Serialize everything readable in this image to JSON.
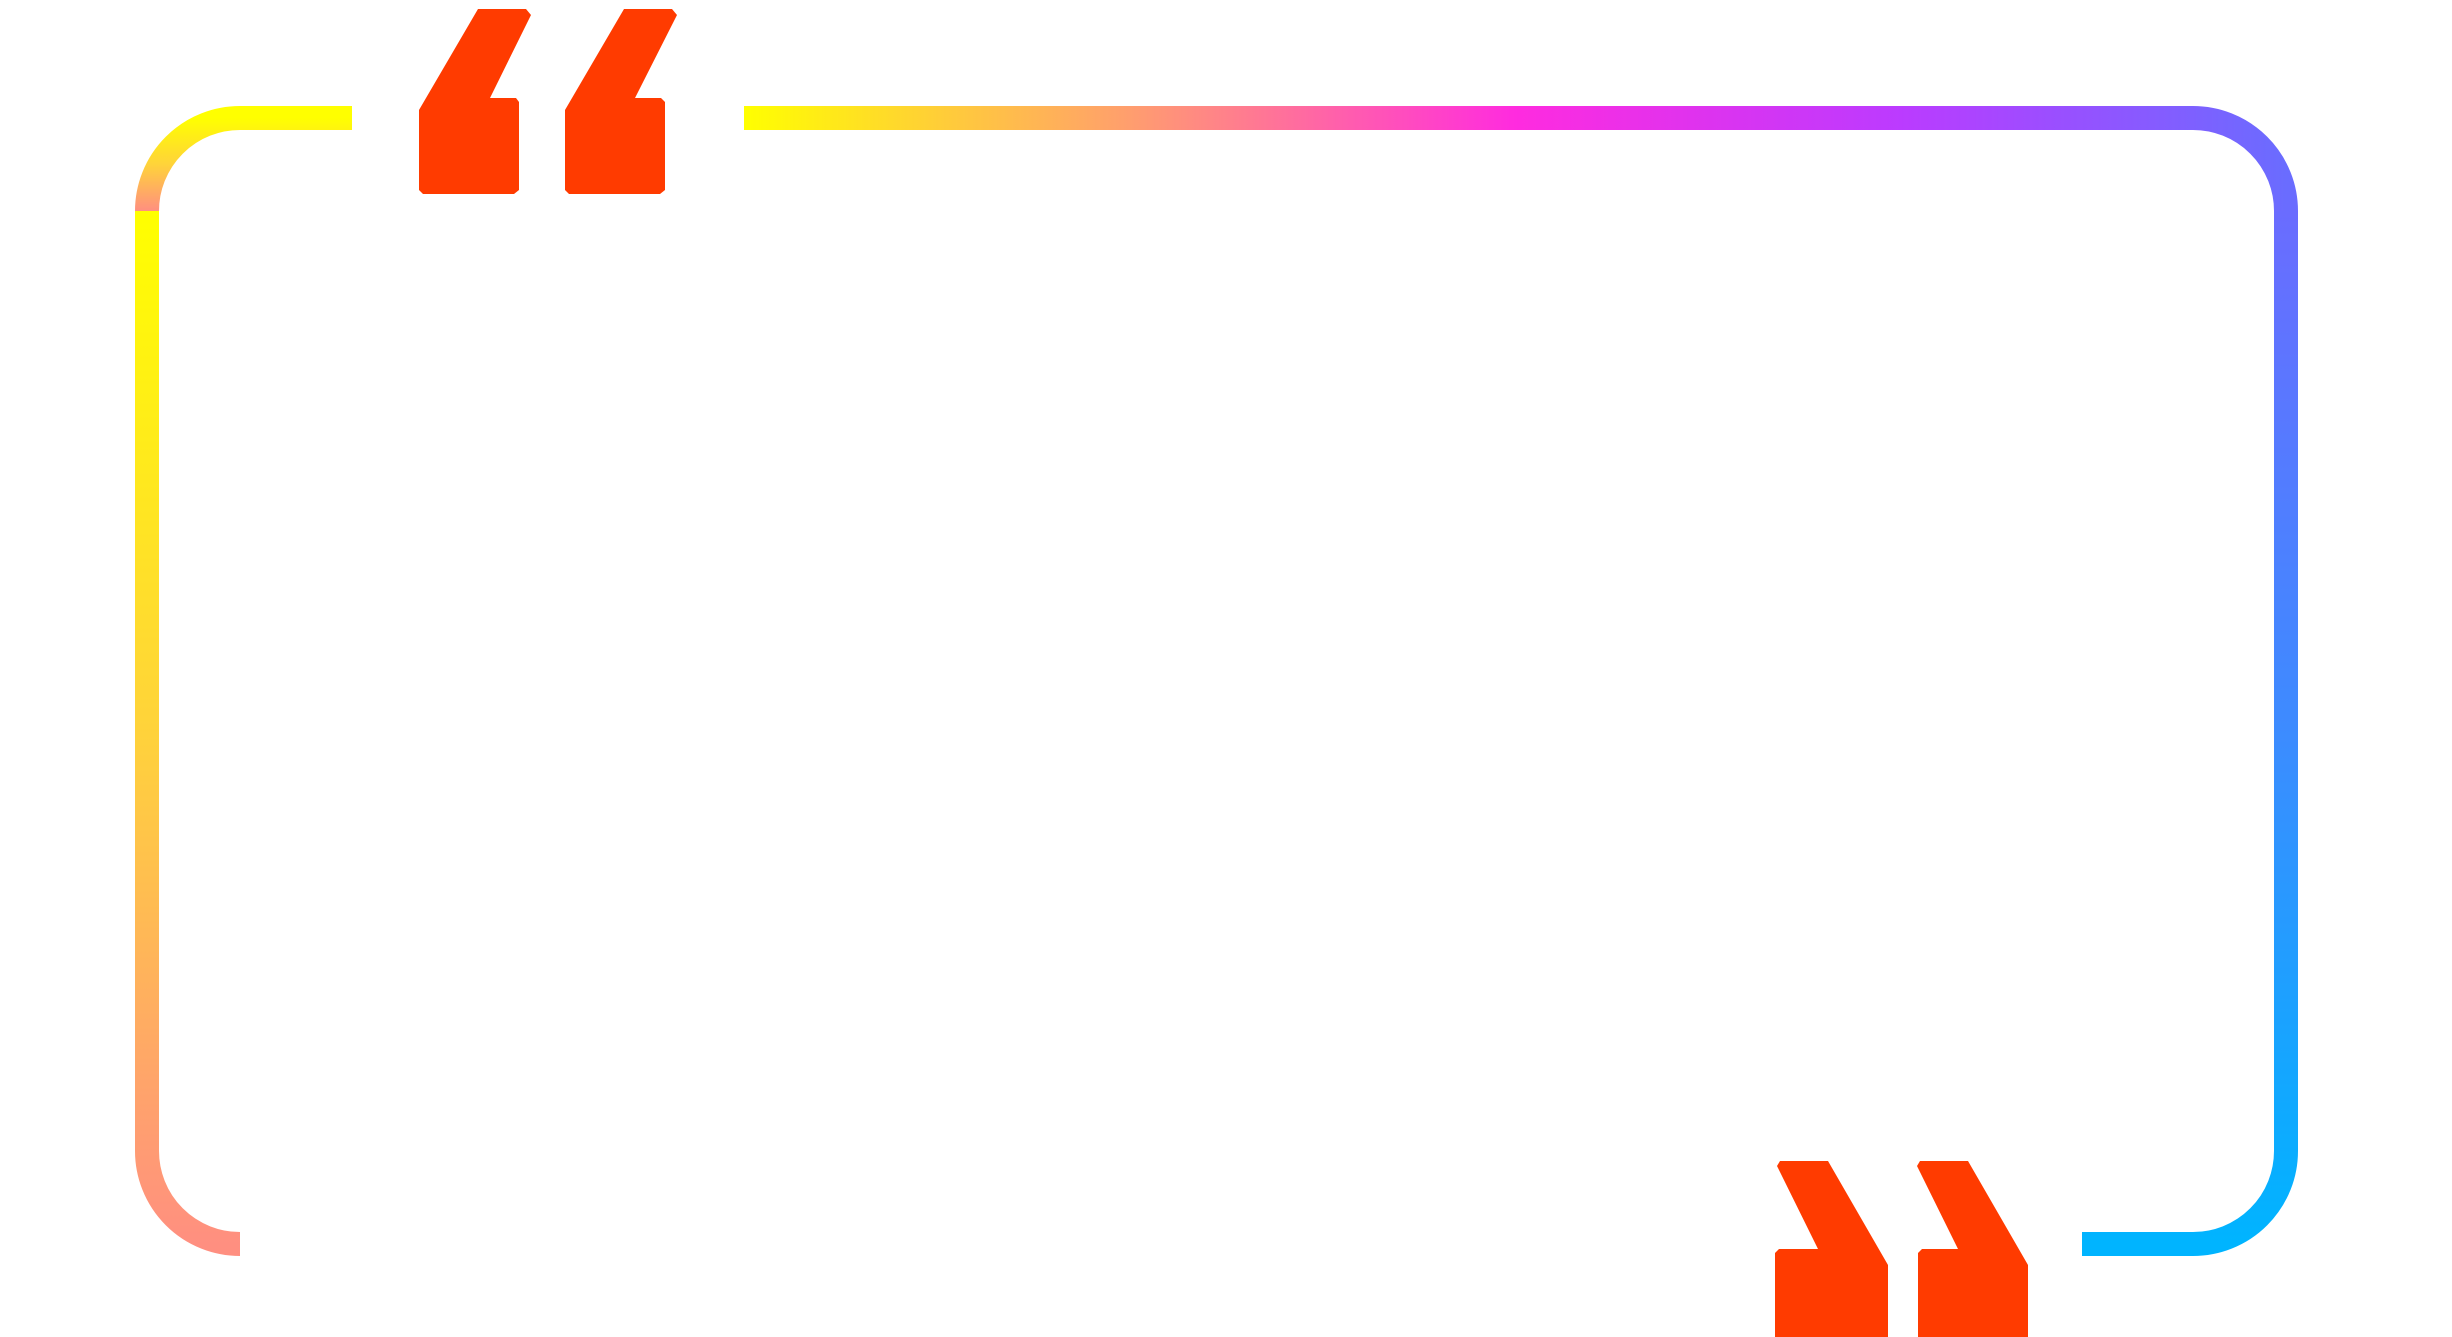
{
  "frame": {
    "gradient_top": [
      "#ffff00",
      "#ff9e6e",
      "#ff2bdf",
      "#bb3bff",
      "#6a6cff"
    ],
    "gradient_right": [
      "#6a6cff",
      "#3d8bff",
      "#00b4ff"
    ],
    "gradient_left": [
      "#ffff00",
      "#ffd33a",
      "#ff8f80"
    ],
    "gradient_bottom": [
      "#ff8f80",
      "#ff2bdf",
      "#c03aff",
      "#6a6cff",
      "#00b4ff"
    ]
  },
  "quote_marks": {
    "color": "#ff3b00",
    "open_glyph": "opening-quote-icon",
    "close_glyph": "closing-quote-icon"
  }
}
